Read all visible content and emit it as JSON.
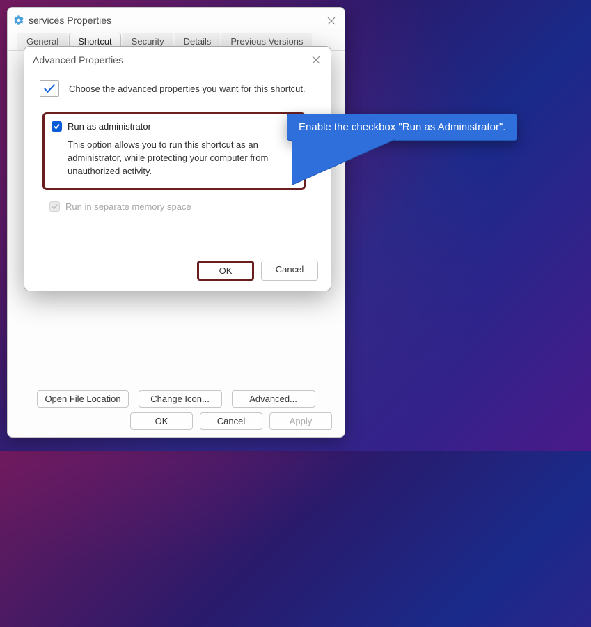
{
  "parent": {
    "title": "services Properties",
    "tabs": {
      "general": "General",
      "shortcut": "Shortcut",
      "security": "Security",
      "details": "Details",
      "previous": "Previous Versions"
    },
    "buttons": {
      "open_file_location": "Open File Location",
      "change_icon": "Change Icon...",
      "advanced": "Advanced..."
    },
    "okcancel": {
      "ok": "OK",
      "cancel": "Cancel",
      "apply": "Apply"
    }
  },
  "child": {
    "title": "Advanced Properties",
    "choose_label": "Choose the advanced properties you want for this shortcut.",
    "run_as_admin": {
      "label": "Run as administrator",
      "description": "This option allows you to run this shortcut as an administrator, while protecting your computer from unauthorized activity."
    },
    "mem_space": {
      "label": "Run in separate memory space"
    },
    "okcancel": {
      "ok": "OK",
      "cancel": "Cancel"
    }
  },
  "callout": {
    "text": "Enable the checkbox \"Run as Administrator\"."
  }
}
